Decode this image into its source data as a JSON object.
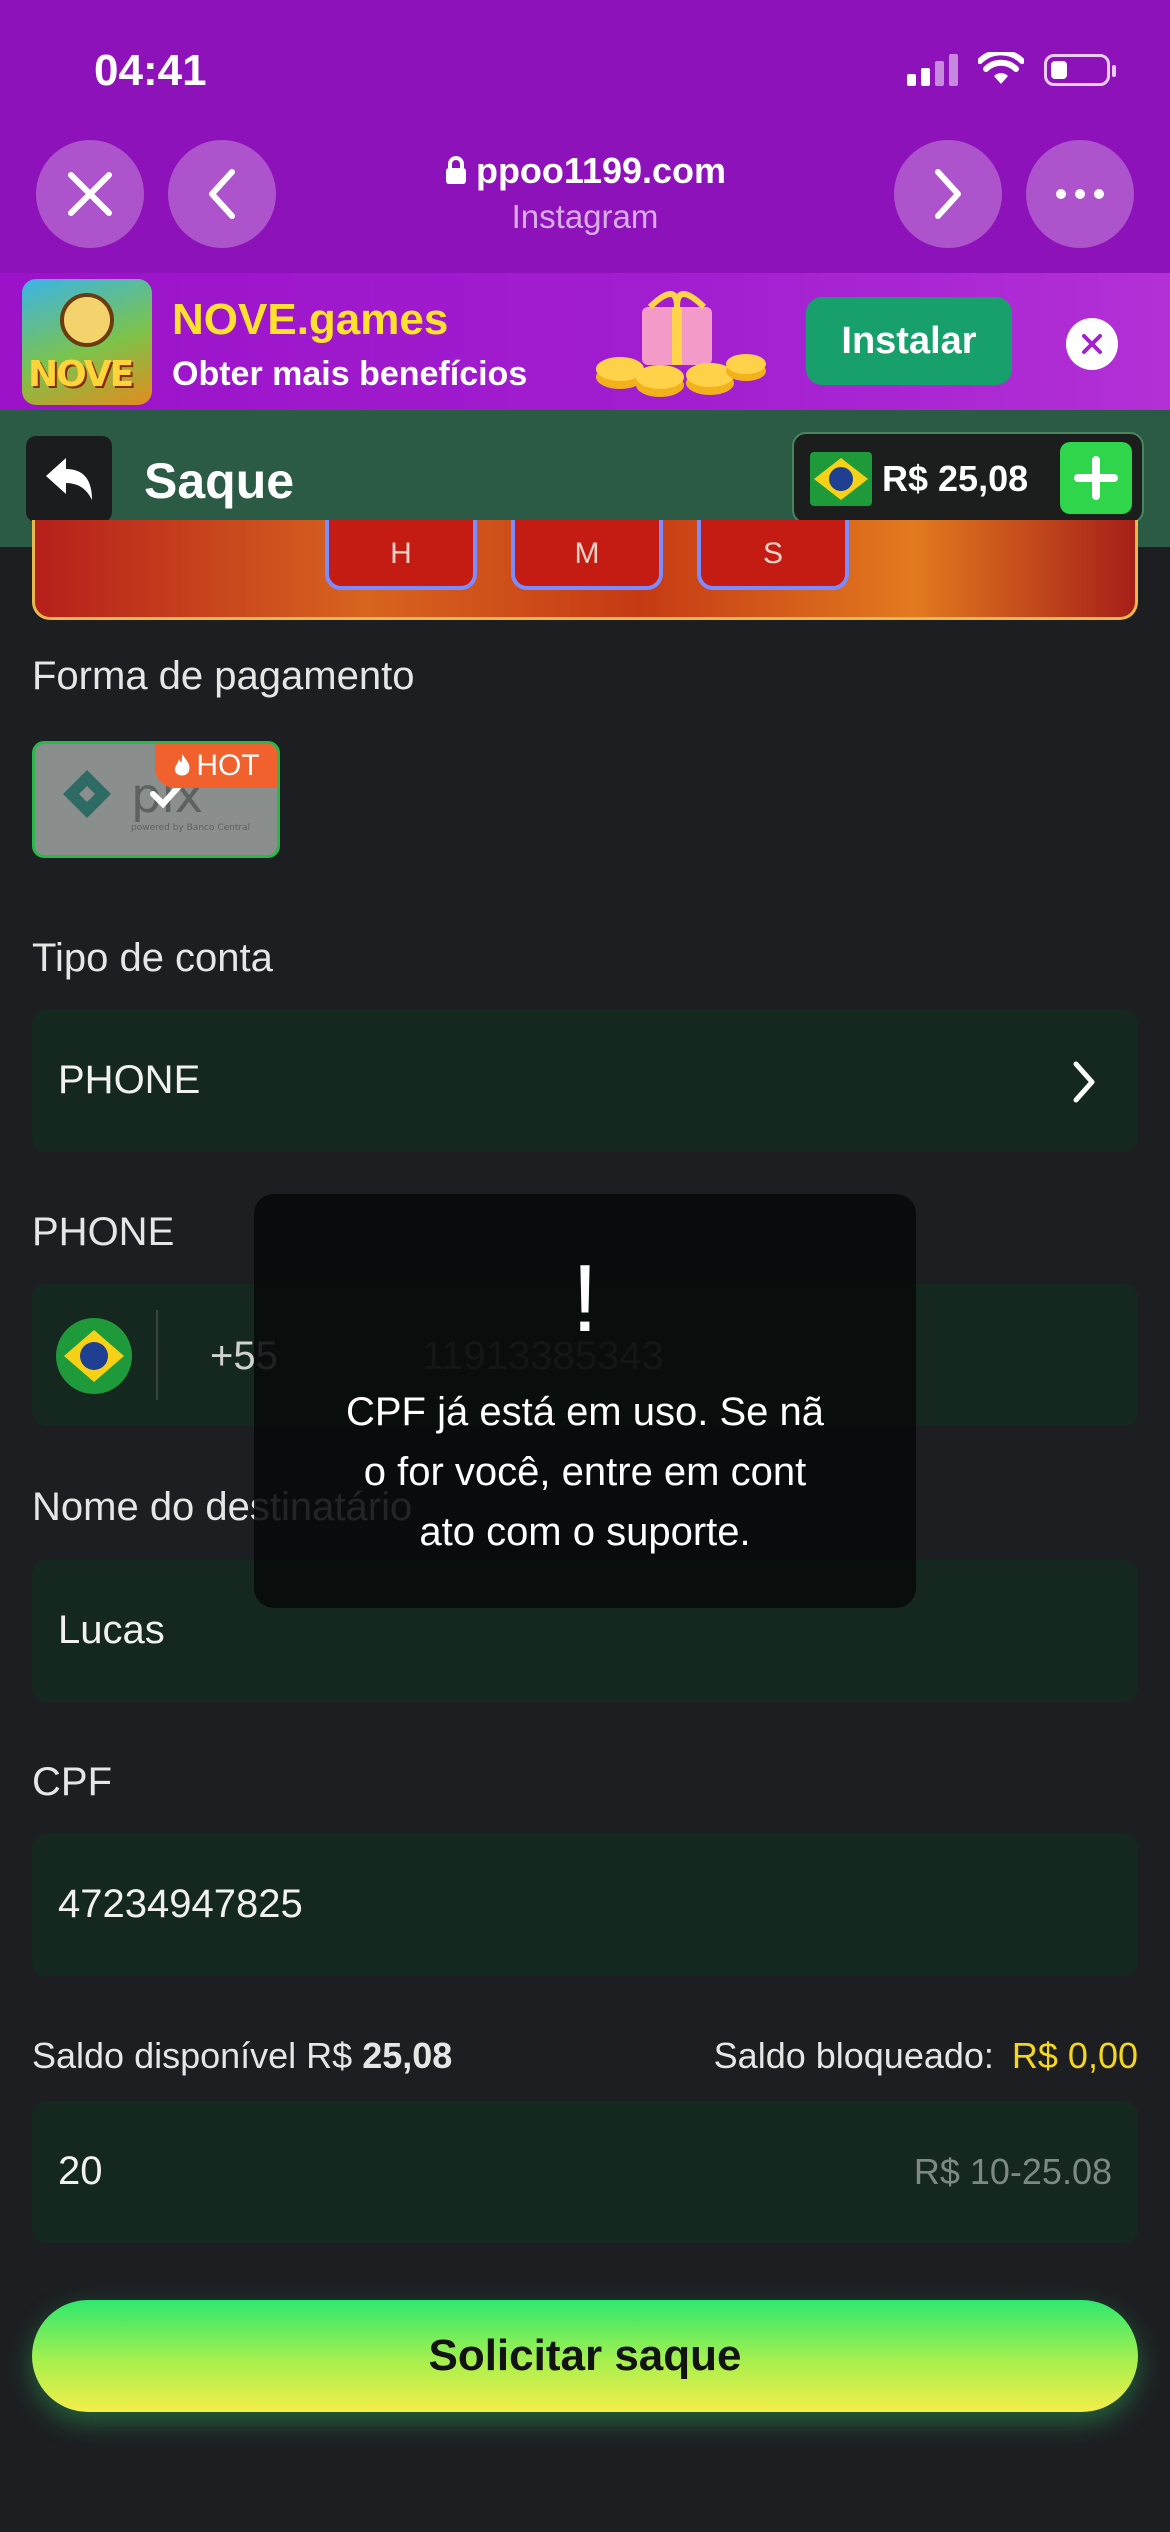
{
  "status_bar": {
    "time": "04:41"
  },
  "browser": {
    "url": "ppoo1199.com",
    "source": "Instagram"
  },
  "ad_banner": {
    "logo_text": "NOVE",
    "title": "NOVE.games",
    "subtitle": "Obter mais benefícios",
    "install_label": "Instalar"
  },
  "header": {
    "title": "Saque",
    "balance": "R$ 25,08"
  },
  "game_strip": {
    "cells": [
      "H",
      "M",
      "S"
    ]
  },
  "form": {
    "payment_method_label": "Forma de pagamento",
    "payment_method_badge": "HOT",
    "account_type_label": "Tipo de conta",
    "account_type_value": "PHONE",
    "phone_label": "PHONE",
    "phone_country_code": "+55",
    "phone_number": "11913385343",
    "recipient_label": "Nome do destinatário",
    "recipient_value": "Lucas",
    "cpf_label": "CPF",
    "cpf_value": "47234947825",
    "available_label": "Saldo disponível R$",
    "available_value": "25,08",
    "blocked_label": "Saldo bloqueado:",
    "blocked_value": "R$ 0,00",
    "amount_value": "20",
    "amount_range": "R$ 10-25.08",
    "submit_label": "Solicitar saque"
  },
  "toast": {
    "icon": "!",
    "line1": "CPF já está em uso. Se nã",
    "line2": "o for você, entre em cont",
    "line3": "ato com o suporte."
  },
  "colors": {
    "browser_bar": "#8e12ba",
    "header_green": "#2c5b45",
    "field_bg": "#15281f",
    "accent_yellow": "#f5d51e",
    "hot_badge": "#f0612d"
  }
}
